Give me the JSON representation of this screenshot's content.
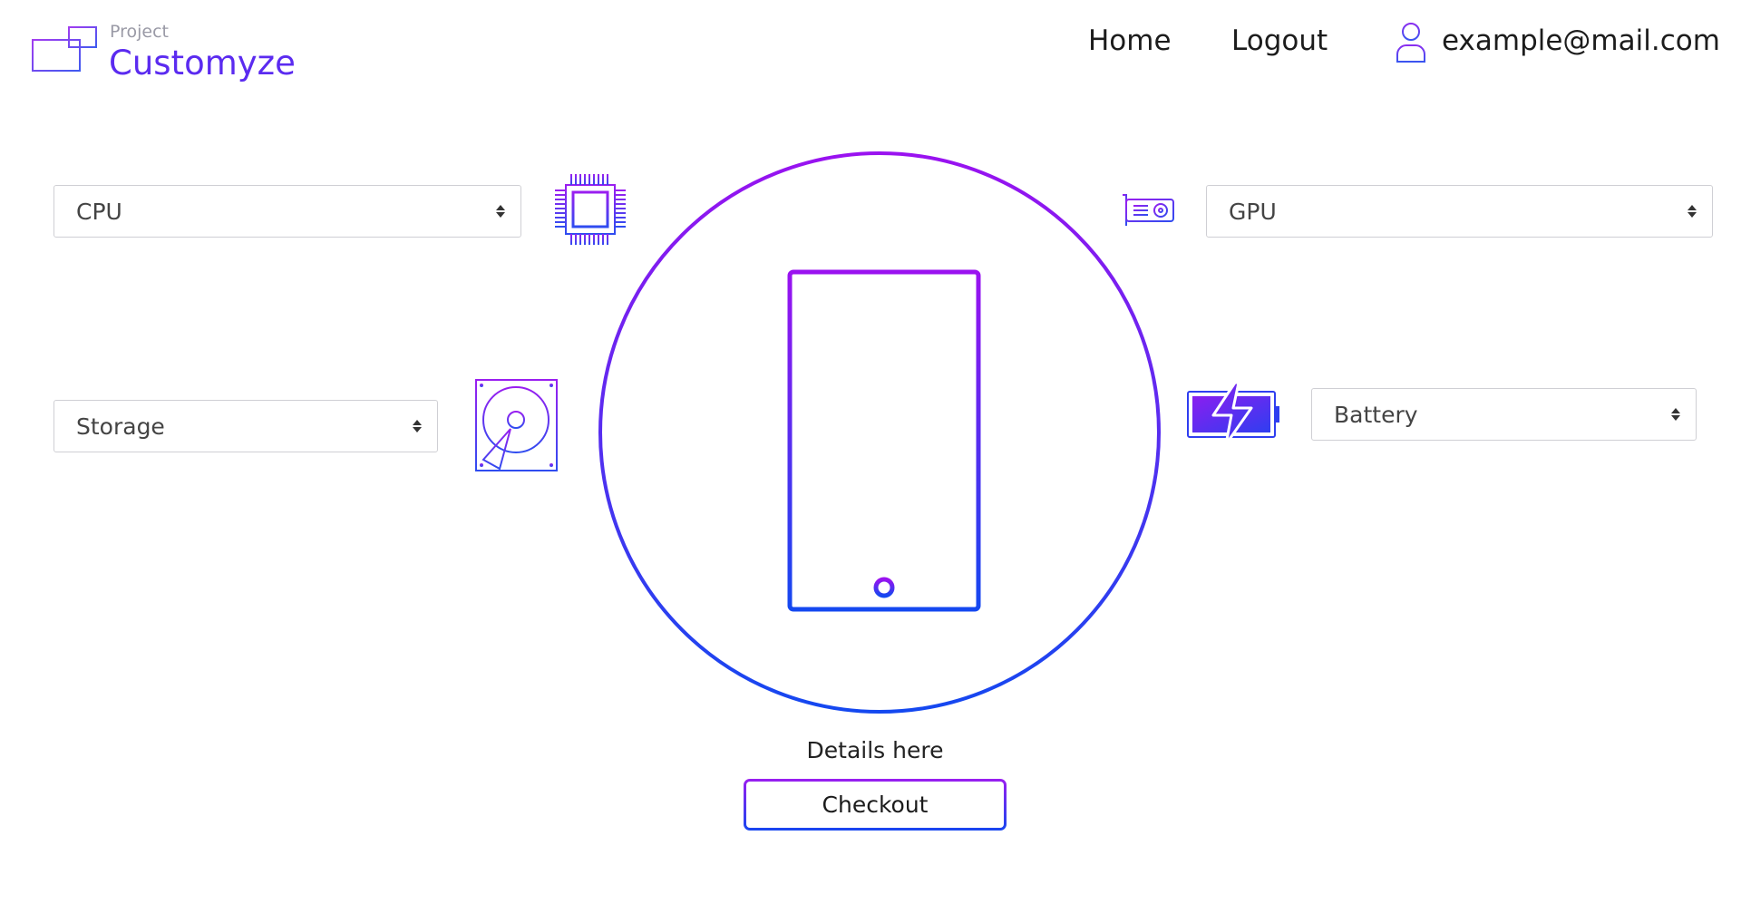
{
  "header": {
    "brand_sub": "Project",
    "brand_title": "Customyze",
    "nav": {
      "home": "Home",
      "logout": "Logout"
    },
    "user_email": "example@mail.com"
  },
  "selects": {
    "cpu": "CPU",
    "gpu": "GPU",
    "storage": "Storage",
    "battery": "Battery"
  },
  "center": {
    "details": "Details here",
    "checkout_label": "Checkout"
  },
  "colors": {
    "brand": "#5b2bf0",
    "gradient_start": "#9a1ef0",
    "gradient_end": "#1746f0"
  },
  "icons": {
    "logo": "devices-logo-icon",
    "user": "user-icon",
    "cpu": "cpu-chip-icon",
    "storage": "hard-drive-icon",
    "gpu": "graphics-card-icon",
    "battery": "battery-charging-icon",
    "phone": "smartphone-icon"
  }
}
